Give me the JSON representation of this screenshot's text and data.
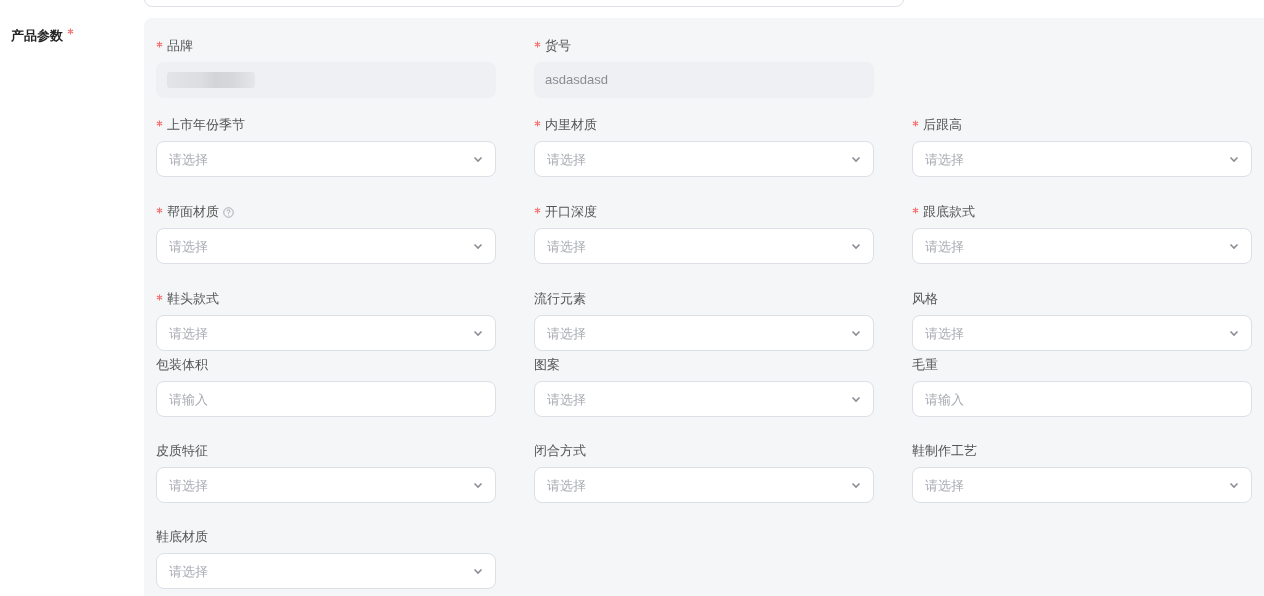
{
  "section": {
    "label": "产品参数",
    "required": true
  },
  "rows": [
    [
      {
        "label": "品牌",
        "required": true,
        "kind": "disabled",
        "redacted": true
      },
      {
        "label": "货号",
        "required": true,
        "kind": "disabled",
        "value": "asdasdasd"
      }
    ],
    [
      {
        "label": "上市年份季节",
        "required": true,
        "kind": "select",
        "placeholder": "请选择"
      },
      {
        "label": "内里材质",
        "required": true,
        "kind": "select",
        "placeholder": "请选择"
      },
      {
        "label": "后跟高",
        "required": true,
        "kind": "select",
        "placeholder": "请选择"
      }
    ],
    [
      {
        "label": "帮面材质",
        "required": true,
        "help": true,
        "kind": "select",
        "placeholder": "请选择"
      },
      {
        "label": "开口深度",
        "required": true,
        "kind": "select",
        "placeholder": "请选择"
      },
      {
        "label": "跟底款式",
        "required": true,
        "kind": "select",
        "placeholder": "请选择"
      }
    ],
    [
      {
        "label": "鞋头款式",
        "required": true,
        "kind": "select",
        "placeholder": "请选择"
      },
      {
        "label": "流行元素",
        "required": false,
        "kind": "select",
        "placeholder": "请选择"
      },
      {
        "label": "风格",
        "required": false,
        "kind": "select",
        "placeholder": "请选择"
      }
    ],
    [
      {
        "label": "包装体积",
        "required": false,
        "kind": "input",
        "placeholder": "请输入"
      },
      {
        "label": "图案",
        "required": false,
        "kind": "select",
        "placeholder": "请选择"
      },
      {
        "label": "毛重",
        "required": false,
        "kind": "input",
        "placeholder": "请输入"
      }
    ],
    [
      {
        "label": "皮质特征",
        "required": false,
        "kind": "select",
        "placeholder": "请选择"
      },
      {
        "label": "闭合方式",
        "required": false,
        "kind": "select",
        "placeholder": "请选择"
      },
      {
        "label": "鞋制作工艺",
        "required": false,
        "kind": "select",
        "placeholder": "请选择"
      }
    ],
    [
      {
        "label": "鞋底材质",
        "required": false,
        "kind": "select",
        "placeholder": "请选择"
      }
    ]
  ]
}
